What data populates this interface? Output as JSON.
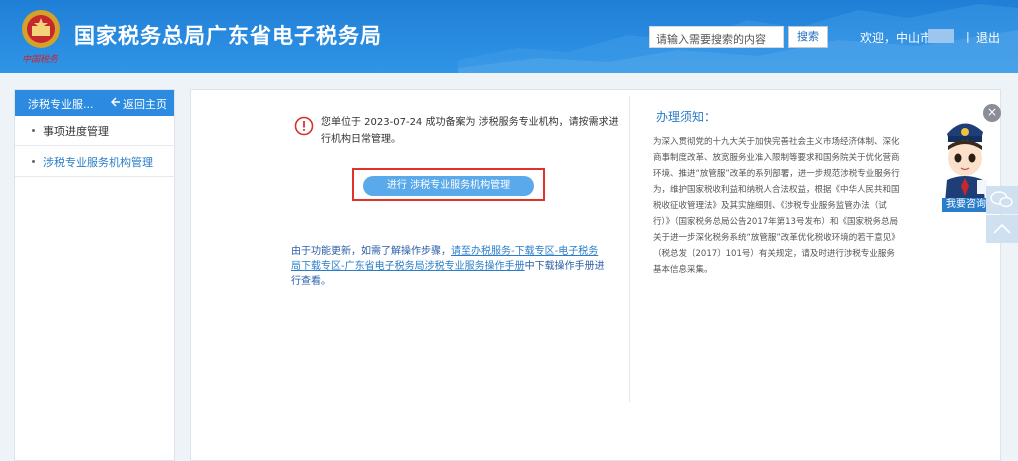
{
  "header": {
    "site_title": "国家税务总局广东省电子税务局",
    "emblem_signature": "中国税务",
    "search_placeholder": "请输入需要搜索的内容",
    "search_button": "搜索",
    "welcome": "欢迎，中山市",
    "separator": "|",
    "logout": "退出",
    "brand_color": "#2a8ce0"
  },
  "sidebar": {
    "title": "涉税专业服...",
    "back_home": "返回主页",
    "items": [
      {
        "label": "事项进度管理"
      },
      {
        "label": "涉税专业服务机构管理"
      }
    ]
  },
  "main": {
    "notice": "您单位于 2023-07-24 成功备案为 涉税服务专业机构，请按需求进行机构日常管理。",
    "action_button": "进行 涉税专业服务机构管理",
    "update_text": {
      "prefix": "由于功能更新，如需了解操作步骤，",
      "link": "请至办税服务-下载专区-电子税务局下载专区-广东省电子税务局涉税专业服务操作手册",
      "suffix": "中下载操作手册进行查看。"
    },
    "guide": {
      "title": "办理须知：",
      "body": "为深入贯彻党的十九大关于加快完善社会主义市场经济体制、深化商事制度改革、放宽服务业准入限制等要求和国务院关于优化营商环境、推进“放管服”改革的系列部署，进一步规范涉税专业服务行为，维护国家税收利益和纳税人合法权益，根据《中华人民共和国税收征收管理法》及其实施细则、《涉税专业服务监管办法（试行）》（国家税务总局公告2017年第13号发布）和《国家税务总局关于进一步深化税务系统“放管服”改革优化税收环境的若干意见》（税总发〔2017〕101号）有关规定，请及时进行涉税专业服务基本信息采集。"
    }
  },
  "widgets": {
    "consult_label": "我要咨询",
    "close_icon": "close-icon"
  }
}
